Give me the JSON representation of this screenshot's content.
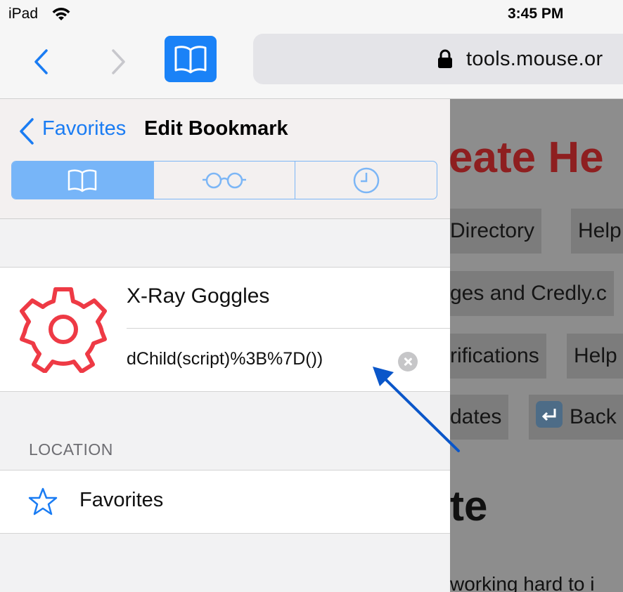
{
  "status_bar": {
    "device": "iPad",
    "time": "3:45 PM"
  },
  "toolbar": {
    "url": "tools.mouse.or"
  },
  "sidebar": {
    "back_label": "Favorites",
    "title": "Edit Bookmark",
    "tabs": [
      "bookmarks-icon",
      "reading-list-icon",
      "history-icon"
    ],
    "active_tab": 0
  },
  "bookmark": {
    "title": "X-Ray Goggles",
    "url": "dChild(script)%3B%7D())",
    "icon": "gear-icon"
  },
  "location": {
    "section_label": "LOCATION",
    "folder": "Favorites"
  },
  "webpage": {
    "heading": "eate He",
    "buttons": [
      "Directory",
      "Help",
      "ges and Credly.c",
      "rifications",
      "Help",
      "dates",
      "Back"
    ],
    "big_text": "te",
    "small_text": "working hard to i"
  },
  "colors": {
    "accent": "#1a7cf3",
    "active_segment": "#77b5f8",
    "gear": "#ee3a45",
    "heading": "#8e1f20"
  }
}
